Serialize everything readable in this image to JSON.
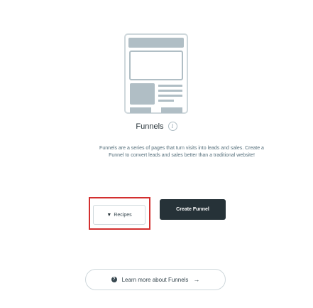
{
  "empty_state": {
    "title": "Funnels",
    "info_icon": "i",
    "description": "Funnels are a series of pages that turn visits into leads and sales. Create a Funnel to convert leads and sales better than a traditional website!"
  },
  "actions": {
    "recipes_label": "Recipes",
    "recipes_icon": "▼",
    "create_funnel_label": "Create Funnel"
  },
  "learn_more": {
    "icon": "?",
    "label": "Learn more about Funnels",
    "arrow": "→"
  },
  "colors": {
    "highlight": "#d32f2f",
    "primary_button": "#263238"
  }
}
